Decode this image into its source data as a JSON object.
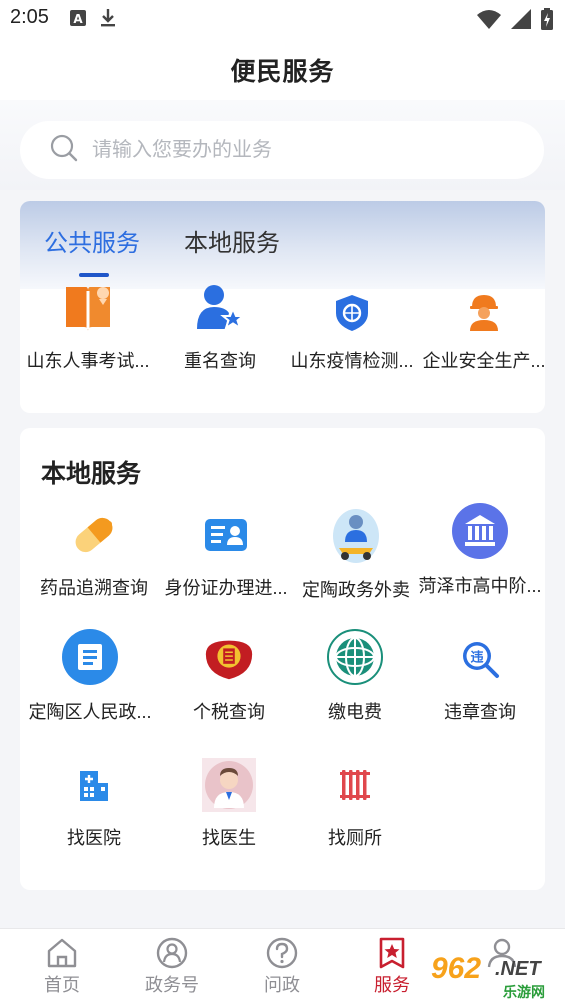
{
  "status_bar": {
    "time": "2:05",
    "left_icons": [
      "keyboard-a-icon",
      "download-icon"
    ],
    "right_icons": [
      "wifi-icon",
      "signal-icon",
      "battery-charging-icon"
    ]
  },
  "header": {
    "title": "便民服务"
  },
  "search": {
    "placeholder": "请输入您要办的业务",
    "value": ""
  },
  "tabs": [
    {
      "label": "公共服务",
      "active": true
    },
    {
      "label": "本地服务",
      "active": false
    }
  ],
  "public_services": [
    {
      "label": "山东人事考试...",
      "icon": "exam-book-icon"
    },
    {
      "label": "重名查询",
      "icon": "user-star-icon"
    },
    {
      "label": "山东疫情检测...",
      "icon": "shield-badge-icon"
    },
    {
      "label": "企业安全生产...",
      "icon": "worker-helmet-icon"
    }
  ],
  "local_section": {
    "title": "本地服务",
    "items": [
      {
        "label": "药品追溯查询",
        "icon": "pill-icon"
      },
      {
        "label": "身份证办理进...",
        "icon": "id-card-icon"
      },
      {
        "label": "定陶政务外卖",
        "icon": "delivery-scooter-icon"
      },
      {
        "label": "菏泽市高中阶...",
        "icon": "institution-building-icon"
      },
      {
        "label": "定陶区人民政...",
        "icon": "document-circle-icon"
      },
      {
        "label": "个税查询",
        "icon": "tax-emblem-icon"
      },
      {
        "label": "缴电费",
        "icon": "state-grid-logo-icon"
      },
      {
        "label": "违章查询",
        "icon": "violation-search-icon"
      },
      {
        "label": "找医院",
        "icon": "hospital-icon"
      },
      {
        "label": "找医生",
        "icon": "doctor-avatar-icon"
      },
      {
        "label": "找厕所",
        "icon": "toilet-icon"
      }
    ]
  },
  "bottom_nav": [
    {
      "label": "首页",
      "icon": "home-icon",
      "active": false
    },
    {
      "label": "政务号",
      "icon": "account-circle-icon",
      "active": false
    },
    {
      "label": "问政",
      "icon": "question-icon",
      "active": false
    },
    {
      "label": "服务",
      "icon": "service-star-icon",
      "active": true
    },
    {
      "label": "",
      "icon": "profile-icon",
      "active": false
    }
  ],
  "watermark": {
    "brand": "962",
    "suffix": ".NET",
    "cn": "乐游网"
  },
  "colors": {
    "accent_blue": "#2d6ee0",
    "tab_underline": "#1f56c9",
    "active_nav_red": "#c81f2f",
    "icon_orange": "#f07a1e",
    "icon_blue": "#2b6fe0",
    "background": "#f4f5f8"
  }
}
